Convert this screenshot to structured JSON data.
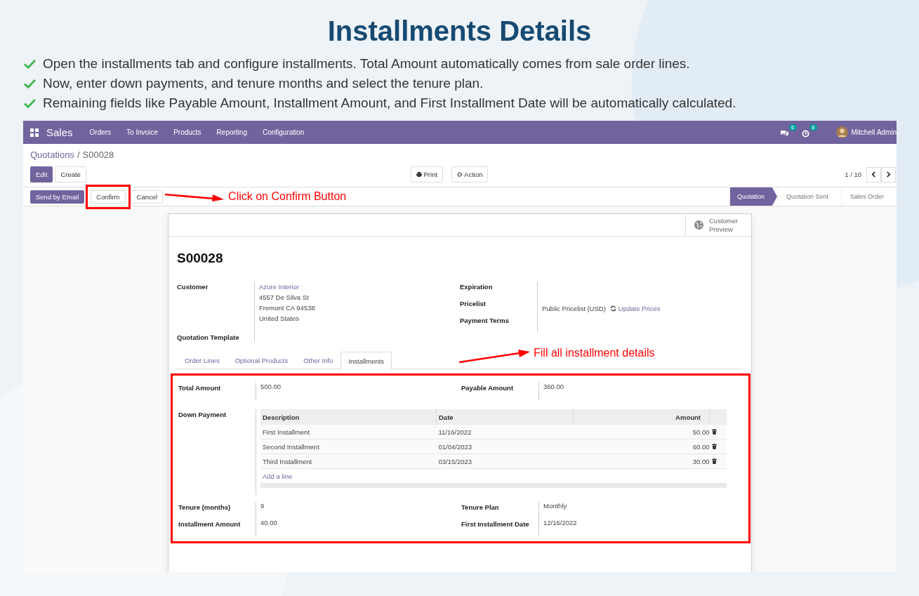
{
  "title": "Installments Details",
  "steps": [
    "Open the installments tab and configure installments. Total Amount automatically comes from sale order lines.",
    "Now, enter down payments, and tenure months and select the tenure plan.",
    "Remaining fields like Payable Amount, Installment Amount, and First Installment Date will be automatically calculated."
  ],
  "navbar": {
    "app": "Sales",
    "menu": [
      "Orders",
      "To Invoice",
      "Products",
      "Reporting",
      "Configuration"
    ],
    "messages_badge": "6",
    "activities_badge": "8",
    "user": "Mitchell Admin"
  },
  "breadcrumb": {
    "parent": "Quotations",
    "separator": "/",
    "current": "S00028"
  },
  "toolbar": {
    "edit": "Edit",
    "create": "Create",
    "print": "Print",
    "action": "Action",
    "pager": "1 / 10"
  },
  "status_buttons": [
    {
      "label": "Send by Email",
      "primary": true,
      "highlighted": false
    },
    {
      "label": "Confirm",
      "primary": false,
      "highlighted": true
    },
    {
      "label": "Cancel",
      "primary": false,
      "highlighted": false
    }
  ],
  "stages": [
    {
      "label": "Quotation",
      "selected": true
    },
    {
      "label": "Quotation Sent",
      "selected": false
    },
    {
      "label": "Sales Order",
      "selected": false
    }
  ],
  "annotations": [
    "Click on Confirm Button",
    "Fill all installment details"
  ],
  "sheet": {
    "customer_preview": "Customer Preview",
    "name": "S00028",
    "customer": {
      "label": "Customer",
      "name": "Azure Interior",
      "address": [
        "4557 De Silva St",
        "Fremont CA 94538",
        "United States"
      ]
    },
    "quotation_template": {
      "label": "Quotation Template"
    },
    "expiration": {
      "label": "Expiration"
    },
    "pricelist": {
      "label": "Pricelist",
      "value": "Public Pricelist (USD)",
      "action": "Update Prices"
    },
    "payment_terms": {
      "label": "Payment Terms"
    },
    "tabs": [
      {
        "label": "Order Lines",
        "selected": false
      },
      {
        "label": "Optional Products",
        "selected": false
      },
      {
        "label": "Other Info",
        "selected": false
      },
      {
        "label": "Installments",
        "selected": true
      }
    ],
    "installments": {
      "total_amount": {
        "label": "Total Amount",
        "value": "500.00"
      },
      "payable_amount": {
        "label": "Payable Amount",
        "value": "360.00"
      },
      "down_payment": {
        "label": "Down Payment",
        "columns": [
          "Description",
          "Date",
          "Amount"
        ],
        "rows": [
          {
            "description": "First Installment",
            "date": "11/16/2022",
            "amount": "50.00"
          },
          {
            "description": "Second Installment",
            "date": "01/04/2023",
            "amount": "60.00"
          },
          {
            "description": "Third Installment",
            "date": "03/15/2023",
            "amount": "30.00"
          }
        ],
        "add_line": "Add a line"
      },
      "tenure_months": {
        "label": "Tenure (months)",
        "value": "9"
      },
      "tenure_plan": {
        "label": "Tenure Plan",
        "value": "Monthly"
      },
      "installment_amount": {
        "label": "Installment Amount",
        "value": "40.00"
      },
      "first_installment_date": {
        "label": "First Installment Date",
        "value": "12/16/2022"
      }
    }
  }
}
